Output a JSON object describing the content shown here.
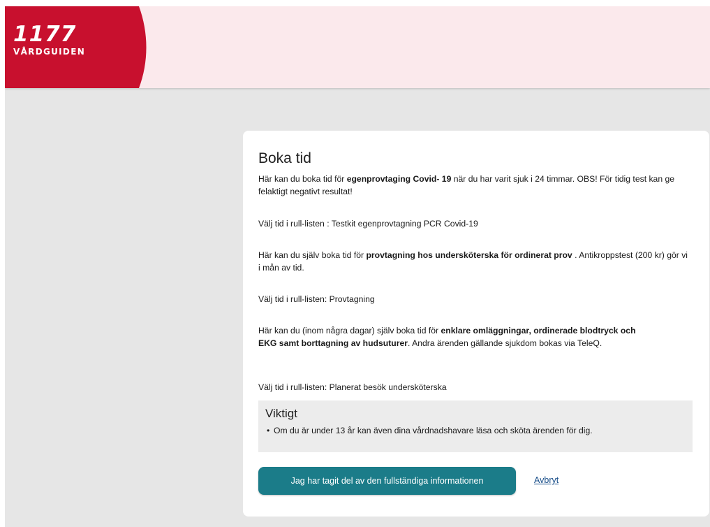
{
  "header": {
    "logo_number": "1177",
    "logo_subtitle": "VÅRDGUIDEN",
    "brand_color": "#c8102e",
    "background_color": "#fbe9ec"
  },
  "dialog": {
    "title": "Boka tid",
    "p1": {
      "a": "Här kan du boka tid för ",
      "b": "egenprovtaging Covid- 19",
      "c": " när du har varit sjuk i 24 timmar. OBS! För tidig test kan  ge felaktigt negativt resultat!"
    },
    "p2": "Välj tid i rull-listen : Testkit egenprovtagning PCR Covid-19",
    "p3": {
      "a": "Här kan du själv boka tid för ",
      "b": "provtagning hos undersköterska för ordinerat prov",
      "c": " . Antikroppstest (200 kr) gör vi i mån av tid."
    },
    "p4": "Välj tid i rull-listen: Provtagning",
    "p5": {
      "a": "Här kan du (inom några dagar) själv boka tid för ",
      "b": "enklare omläggningar, ordinerade blodtryck och EKG samt borttagning av hudsuturer",
      "c": ".  Andra ärenden gällande sjukdom bokas via TeleQ."
    },
    "p6": "Välj tid i rull-listen: Planerat besök undersköterska",
    "important": {
      "title": "Viktigt",
      "items": [
        "Om du är under 13 år kan även dina vårdnadshavare läsa och sköta ärenden för dig."
      ]
    },
    "confirm_label": "Jag har tagit del av den fullständiga informationen",
    "cancel_label": "Avbryt",
    "accent_color": "#1b7c89"
  }
}
